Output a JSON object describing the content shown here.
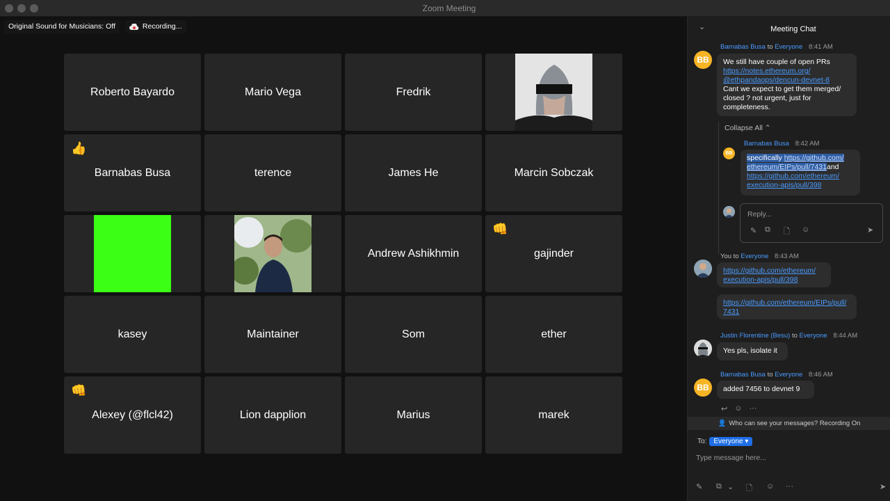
{
  "window": {
    "title": "Zoom Meeting"
  },
  "status": {
    "sound": "Original Sound for Musicians: Off",
    "recording": "Recording..."
  },
  "grid": {
    "tiles": [
      {
        "name": "Roberto Bayardo",
        "reaction": ""
      },
      {
        "name": "Mario Vega",
        "reaction": ""
      },
      {
        "name": "Fredrik",
        "reaction": ""
      },
      {
        "name": "",
        "reaction": ""
      },
      {
        "name": "Barnabas Busa",
        "reaction": "👍"
      },
      {
        "name": "terence",
        "reaction": ""
      },
      {
        "name": "James He",
        "reaction": ""
      },
      {
        "name": "Marcin Sobczak",
        "reaction": ""
      },
      {
        "name": "",
        "reaction": ""
      },
      {
        "name": "",
        "reaction": ""
      },
      {
        "name": "Andrew Ashikhmin",
        "reaction": ""
      },
      {
        "name": "gajinder",
        "reaction": "👊"
      },
      {
        "name": "kasey",
        "reaction": ""
      },
      {
        "name": "Maintainer",
        "reaction": ""
      },
      {
        "name": "Som",
        "reaction": ""
      },
      {
        "name": "ether",
        "reaction": ""
      },
      {
        "name": "Alexey (@flcl42)",
        "reaction": "👊"
      },
      {
        "name": "Lion dapplion",
        "reaction": ""
      },
      {
        "name": "Marius",
        "reaction": ""
      },
      {
        "name": "marek",
        "reaction": ""
      }
    ]
  },
  "chat": {
    "title": "Meeting Chat",
    "to_word": "to",
    "collapse_all": "Collapse All",
    "messages": [
      {
        "avatar": "BB",
        "sender": "Barnabas Busa",
        "recipient": "Everyone",
        "time": "8:41 AM",
        "line1": "We still have couple of open PRs",
        "link1": "https://notes.ethereum.org/",
        "link2": "@ethpandaops/dencun-devnet-8",
        "line2": "Cant we expect to get them merged/",
        "line3": "closed ? not urgent, just for",
        "line4": "completeness."
      },
      {
        "avatar": "BB",
        "sender": "Barnabas Busa",
        "time": "8:42 AM",
        "word": "specifically",
        "link1a": "https://github.com/",
        "link1b": "ethereum/EIPs/pull/7431",
        "and": "and",
        "link2a": "https://github.com/ethereum/",
        "link2b": "execution-apis/pull/398"
      },
      {
        "sender": "You",
        "recipient": "Everyone",
        "time": "8:43 AM",
        "link1a": "https://github.com/ethereum/",
        "link1b": "execution-apis/pull/398",
        "link2a": "https://github.com/ethereum/EIPs/pull/",
        "link2b": "7431"
      },
      {
        "sender": "Justin Florentine (Besu)",
        "recipient": "Everyone",
        "time": "8:44 AM",
        "text": "Yes pls, isolate it"
      },
      {
        "avatar": "BB",
        "sender": "Barnabas Busa",
        "recipient": "Everyone",
        "time": "8:46 AM",
        "text": "added 7456 to devnet 9"
      }
    ],
    "reply": {
      "placeholder": "Reply..."
    },
    "privacy": "Who can see your messages? Recording On",
    "to_label": "To:",
    "to_value": "Everyone",
    "input_placeholder": "Type message here..."
  },
  "colors": {
    "accent": "#4a9bff",
    "avatar_bb": "#f6b524",
    "green_video": "#3bff14",
    "select": "#1f6ee6"
  }
}
